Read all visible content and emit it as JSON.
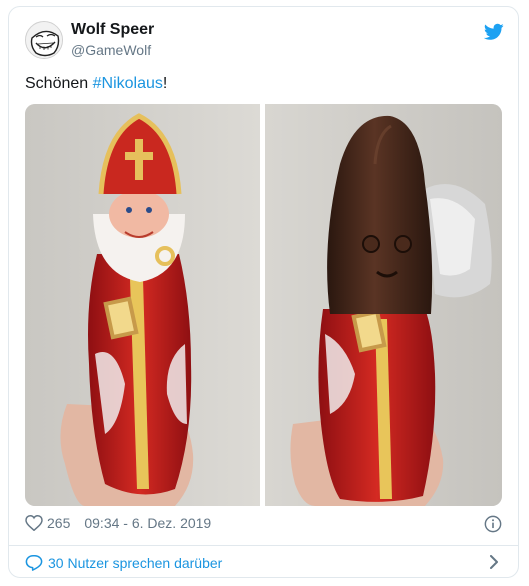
{
  "author": {
    "name": "Wolf Speer",
    "handle": "@GameWolf"
  },
  "tweet": {
    "text_prefix": "Schönen ",
    "hashtag": "#Nikolaus",
    "text_suffix": "!"
  },
  "meta": {
    "likes": "265",
    "timestamp": "09:34 - 6. Dez. 2019"
  },
  "footer": {
    "conversation": "30 Nutzer sprechen darüber"
  },
  "icons": {
    "bird": "twitter-bird-icon",
    "heart": "heart-icon",
    "info": "info-icon",
    "bubble": "speech-bubble-icon",
    "chevron": "chevron-right-icon"
  },
  "colors": {
    "accent": "#1b95e0",
    "secondary_text": "#657786",
    "twitter_blue": "#1da1f2",
    "border": "#e1e8ed"
  }
}
